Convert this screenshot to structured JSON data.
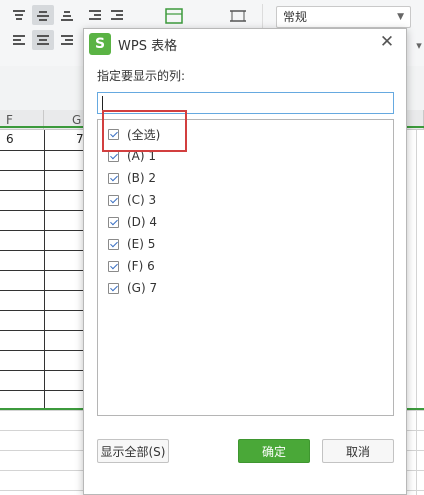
{
  "ribbon": {
    "number_format_value": "常规"
  },
  "sheet": {
    "columns": [
      "F",
      "G"
    ],
    "first_row_values": [
      "6",
      "7"
    ]
  },
  "dialog": {
    "title": "WPS 表格",
    "logo_letter": "S",
    "close_glyph": "✕",
    "prompt": "指定要显示的列:",
    "search_value": "",
    "items": [
      {
        "label": "(全选)",
        "checked": true
      },
      {
        "label": "(A) 1",
        "checked": true
      },
      {
        "label": "(B) 2",
        "checked": true
      },
      {
        "label": "(C) 3",
        "checked": true
      },
      {
        "label": "(D) 4",
        "checked": true
      },
      {
        "label": "(E) 5",
        "checked": true
      },
      {
        "label": "(F) 6",
        "checked": true
      },
      {
        "label": "(G) 7",
        "checked": true
      }
    ],
    "show_all_label": "显示全部(S)",
    "ok_label": "确定",
    "cancel_label": "取消"
  },
  "colors": {
    "accent_green": "#4aa838",
    "highlight_red": "#d23f3f",
    "grid_green": "#3c9a3c"
  }
}
